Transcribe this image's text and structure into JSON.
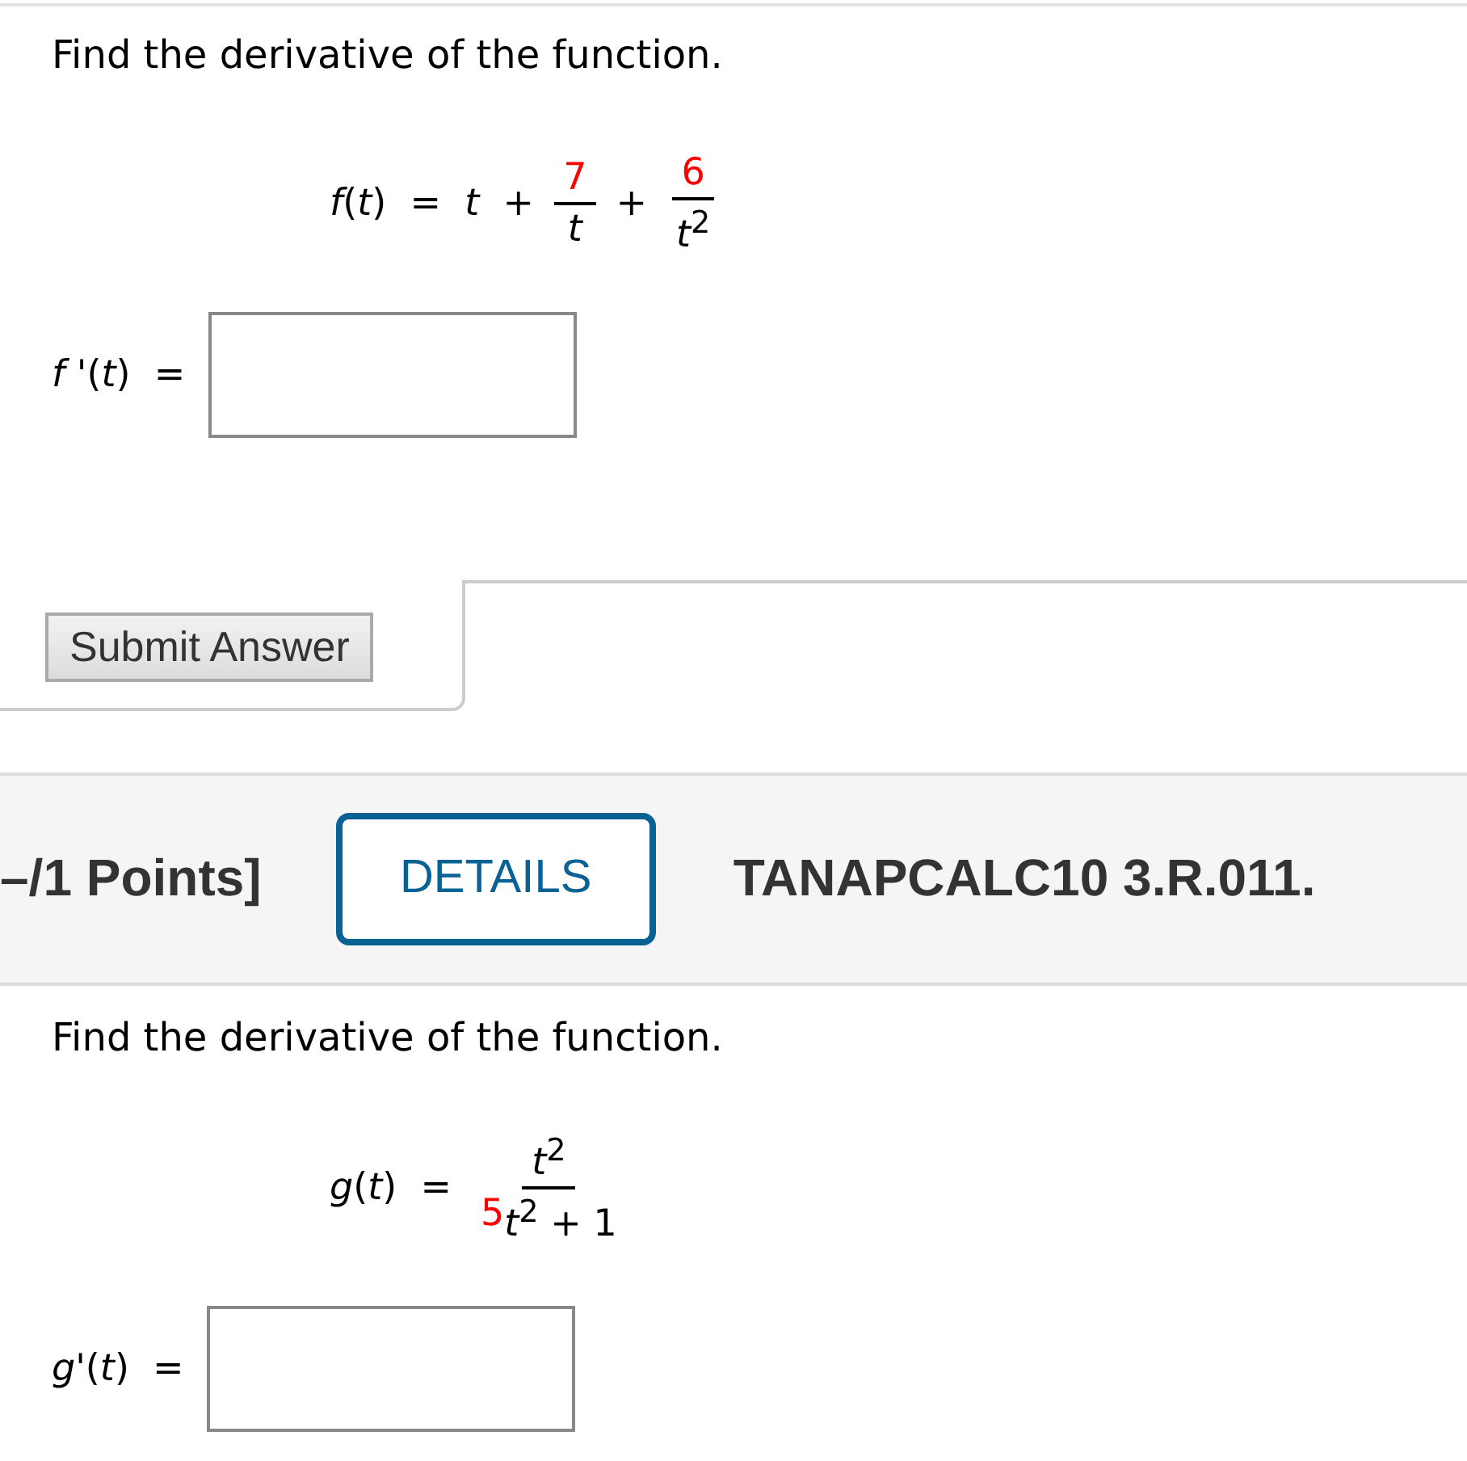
{
  "question_1": {
    "prompt": "Find the derivative of the function.",
    "equation": [
      {
        "kind": "text",
        "text": "*f*(*t*)  =  *t*  +"
      },
      {
        "kind": "frac",
        "num": [
          {
            "text": "7",
            "highlight": true
          }
        ],
        "den": [
          {
            "text": "*t*",
            "highlight": false
          }
        ]
      },
      {
        "kind": "text",
        "text": "+"
      },
      {
        "kind": "frac",
        "num": [
          {
            "text": "6",
            "highlight": true
          }
        ],
        "den": [
          {
            "text": "*t*$^{2}$",
            "highlight": false
          }
        ]
      }
    ],
    "answer": {
      "label": "*f* '(*t*)  ="
    }
  },
  "submit_button": "Submit Answer",
  "problem_header": {
    "points": "–/1 Points]",
    "details_button": "DETAILS",
    "problem_id": "TANAPCALC10 3.R.011."
  },
  "question_2": {
    "prompt": "Find the derivative of the function.",
    "equation": [
      {
        "kind": "text",
        "text": "*g*(*t*)  ="
      },
      {
        "kind": "frac",
        "num": [
          {
            "text": "*t*$^{2}$",
            "highlight": false
          }
        ],
        "den": [
          {
            "text": "5",
            "highlight": true
          },
          {
            "text": "*t*$^{2}$ + 1",
            "highlight": false
          }
        ]
      }
    ],
    "answer": {
      "label": "*g*'(*t*)  ="
    }
  }
}
